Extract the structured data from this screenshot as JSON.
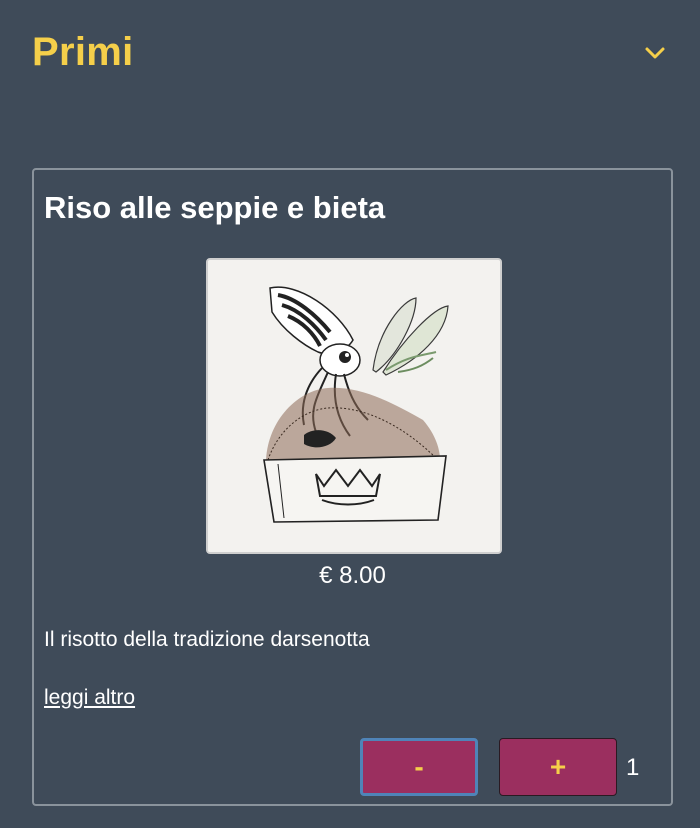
{
  "section": {
    "title": "Primi",
    "toggle_icon": "chevron-down-icon",
    "accent_color": "#f5cf4a"
  },
  "dish": {
    "title": "Riso alle seppie e bieta",
    "image_icon": "cuttlefish-risotto-illustration",
    "price": "€ 8.00",
    "description": "Il risotto della tradizione darsenotta",
    "read_more": "leggi altro",
    "minus_label": "-",
    "plus_label": "+",
    "quantity": "1",
    "button_color": "#9b2f5f"
  }
}
